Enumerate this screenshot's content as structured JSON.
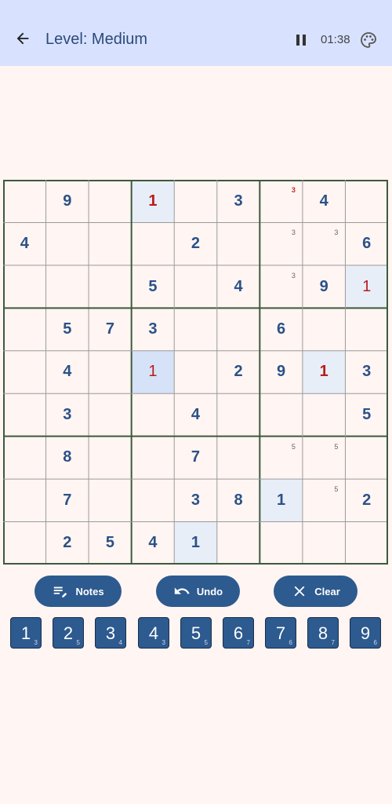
{
  "app_bar": {
    "back_icon": "arrow-back-icon",
    "title": "Level: Medium",
    "pause_icon": "pause-icon",
    "timer": "01:38",
    "theme_icon": "palette-icon"
  },
  "board": {
    "rows": [
      [
        "",
        "9",
        "",
        "1",
        "",
        "3",
        "",
        "4",
        ""
      ],
      [
        "4",
        "",
        "",
        "",
        "2",
        "",
        "",
        "",
        "6"
      ],
      [
        "",
        "",
        "",
        "5",
        "",
        "4",
        "",
        "9",
        "1"
      ],
      [
        "",
        "5",
        "7",
        "3",
        "",
        "",
        "6",
        "",
        ""
      ],
      [
        "",
        "4",
        "",
        "1",
        "",
        "2",
        "9",
        "1",
        "3"
      ],
      [
        "",
        "3",
        "",
        "",
        "4",
        "",
        "",
        "",
        "5"
      ],
      [
        "",
        "8",
        "",
        "",
        "7",
        "",
        "",
        "",
        ""
      ],
      [
        "",
        "7",
        "",
        "",
        "3",
        "8",
        "1",
        "",
        "2"
      ],
      [
        "",
        "2",
        "5",
        "4",
        "1",
        "",
        "",
        "",
        ""
      ]
    ],
    "notes": [
      {
        "row": 0,
        "col": 6,
        "text": "3",
        "style": "red"
      },
      {
        "row": 1,
        "col": 6,
        "text": "3"
      },
      {
        "row": 1,
        "col": 7,
        "text": "3"
      },
      {
        "row": 2,
        "col": 6,
        "text": "3"
      },
      {
        "row": 6,
        "col": 6,
        "text": "5"
      },
      {
        "row": 6,
        "col": 7,
        "text": "5"
      },
      {
        "row": 7,
        "col": 7,
        "text": "5"
      }
    ],
    "highlights": [
      {
        "row": 0,
        "col": 3,
        "color": "#e8eef8"
      },
      {
        "row": 2,
        "col": 8,
        "color": "#e8eef8"
      },
      {
        "row": 4,
        "col": 3,
        "color": "#d6e2f7"
      },
      {
        "row": 4,
        "col": 7,
        "color": "#e8eef8"
      },
      {
        "row": 7,
        "col": 6,
        "color": "#e8eef8"
      },
      {
        "row": 8,
        "col": 4,
        "color": "#e8eef8"
      }
    ],
    "error_cells": [
      [
        0,
        3
      ],
      [
        4,
        7
      ]
    ],
    "user_cells": [
      [
        2,
        8
      ],
      [
        4,
        3
      ]
    ],
    "grid_colors": {
      "thick": "#3d5a3d",
      "thin": "#9a9a9a"
    }
  },
  "actions": {
    "notes": {
      "label": "Notes",
      "icon": "notes-edit-icon"
    },
    "undo": {
      "label": "Undo",
      "icon": "undo-icon"
    },
    "clear": {
      "label": "Clear",
      "icon": "close-icon"
    }
  },
  "numpad": [
    {
      "digit": "1",
      "remaining": "3"
    },
    {
      "digit": "2",
      "remaining": "5"
    },
    {
      "digit": "3",
      "remaining": "4"
    },
    {
      "digit": "4",
      "remaining": "3"
    },
    {
      "digit": "5",
      "remaining": "5"
    },
    {
      "digit": "6",
      "remaining": "7"
    },
    {
      "digit": "7",
      "remaining": "6"
    },
    {
      "digit": "8",
      "remaining": "7"
    },
    {
      "digit": "9",
      "remaining": "6"
    }
  ]
}
